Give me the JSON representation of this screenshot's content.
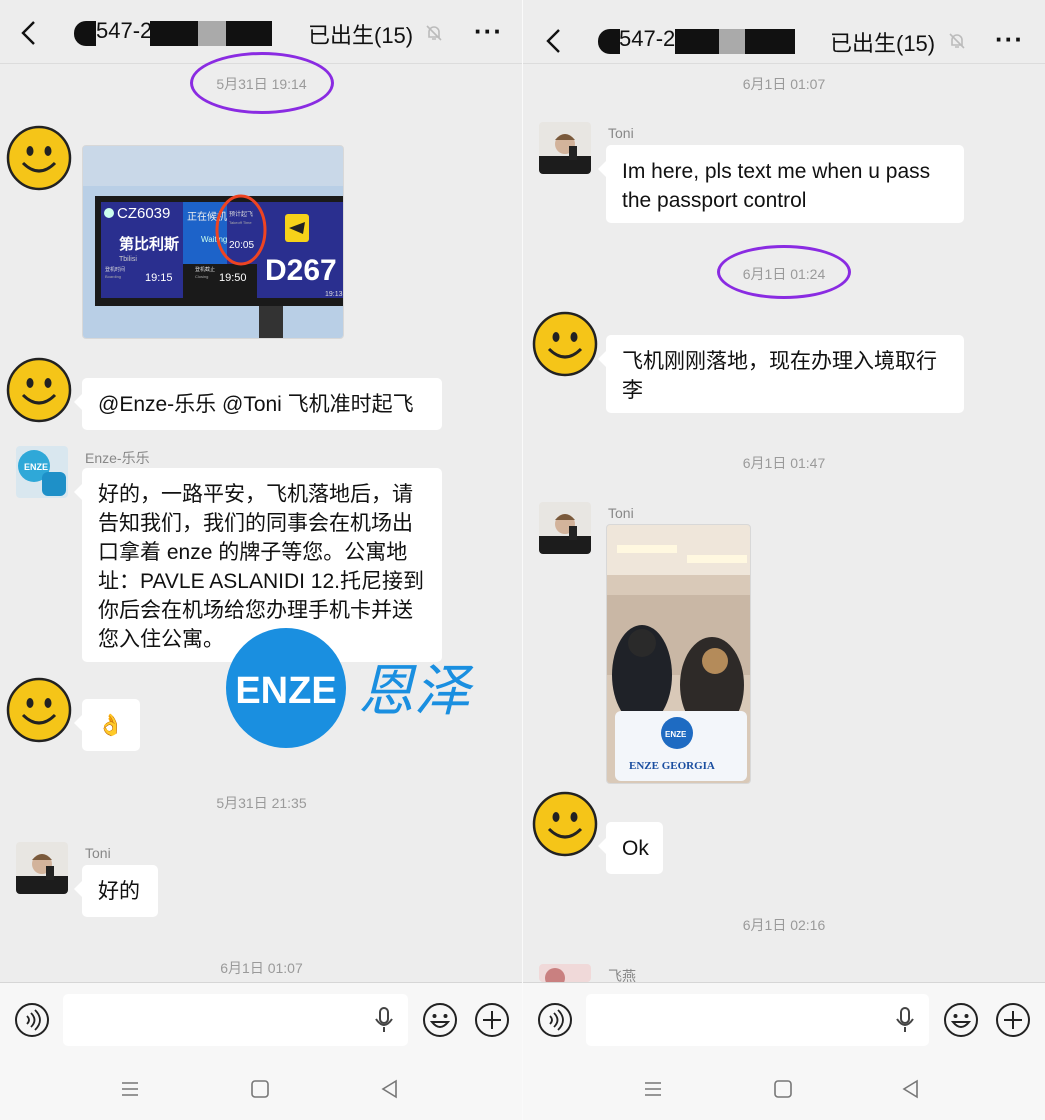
{
  "left": {
    "header": {
      "chat_id": "547-2",
      "group_name": "已出生(15)",
      "more_label": "···"
    },
    "times": [
      "5月31日 19:14",
      "5月31日 21:35",
      "6月1日 01:07"
    ],
    "messages": {
      "mention": "@Enze-乐乐  @Toni  飞机准时起飞",
      "enze_sender": "Enze-乐乐",
      "enze_text": "好的，一路平安，飞机落地后，请告知我们，我们的同事会在机场出口拿着 enze 的牌子等您。公寓地址：PAVLE ASLANIDI 12.托尼接到你后会在机场给您办理手机卡并送您入住公寓。",
      "ok_emoji": "👌",
      "toni_sender": "Toni",
      "toni_text": "好的"
    },
    "board": {
      "flight": "CZ6039",
      "dest_cn": "第比利斯",
      "dest_en": "Tbilisi",
      "status_cn": "正在候机",
      "status_en": "Waiting",
      "time_label_cn": "预计起飞",
      "time_label_en": "Takeoff Time",
      "dep_time": "20:05",
      "boarding_cn": "登机时间",
      "boarding_en": "Boarding",
      "boarding_time": "19:15",
      "closing_cn": "登机截止",
      "closing_en": "Closing",
      "closing_time": "19:50",
      "gate": "D267",
      "corner_time": "19:13"
    }
  },
  "right": {
    "header": {
      "chat_id": "547-2",
      "group_name": "已出生(15)",
      "more_label": "···"
    },
    "times": [
      "6月1日 01:07",
      "6月1日 01:24",
      "6月1日 01:47",
      "6月1日 02:16"
    ],
    "messages": {
      "toni_sender": "Toni",
      "toni_text": "Im here, pls text me when u pass the passport control",
      "landed_text": "飞机刚刚落地，现在办理入境取行李",
      "toni_sender2": "Toni",
      "ok_text": "Ok",
      "feiyan_sender": "飞燕"
    },
    "sign": {
      "logo": "ENZE",
      "caption": "ENZE GEORGIA"
    }
  },
  "watermark": {
    "logo": "ENZE",
    "cn": "恩泽"
  },
  "colors": {
    "accent_circle": "#8a2be2",
    "bg": "#ededed",
    "brand_blue": "#1a8fe0"
  }
}
